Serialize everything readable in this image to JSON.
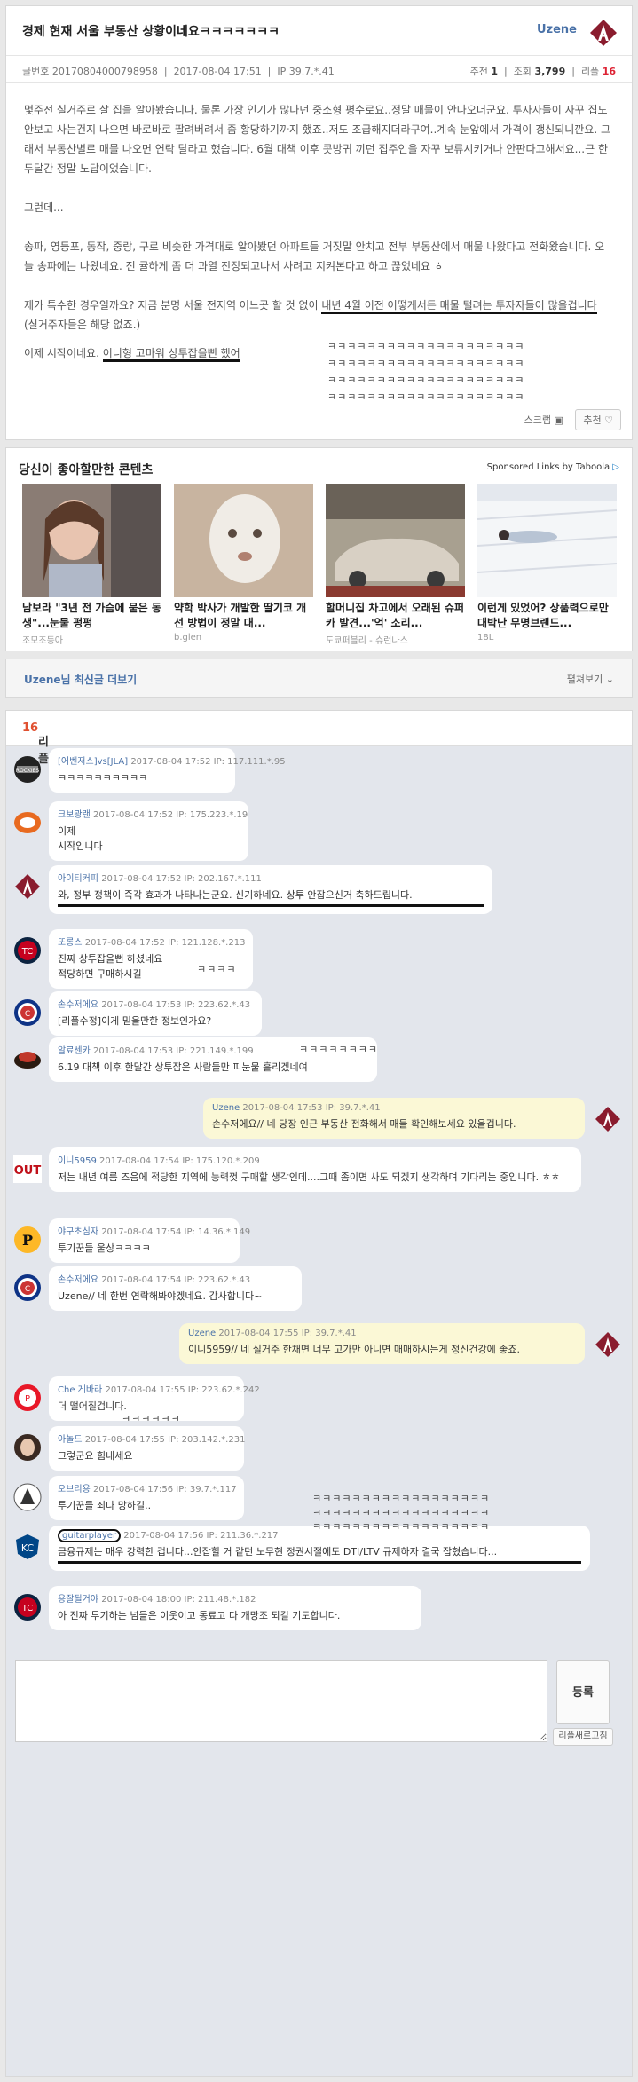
{
  "post": {
    "title": "경제 현재 서울 부동산 상황이네요ㅋㅋㅋㅋㅋㅋㅋ",
    "author": "Uzene",
    "number_label": "글번호",
    "number": "20170804000798958",
    "date": "2017-08-04 17:51",
    "ip_label": "IP",
    "ip": "39.7.*.41",
    "recommend_label": "추천",
    "recommend": "1",
    "views_label": "조회",
    "views": "3,799",
    "replies_label": "리플",
    "replies": "16",
    "paragraphs": [
      "몇주전 실거주로 살 집을 알아봤습니다. 물론 가장 인기가 많다던 중소형 평수로요..정말 매물이 안나오더군요. 투자자들이 자꾸 집도 안보고 사는건지 나오면 바로바로 팔려버려서 좀 황당하기까지 했죠..저도 조급해지더라구여..계속 눈앞에서 가격이 갱신되니깐요. 그래서 부동산별로 매물 나오면 연락 달라고 했습니다. 6월 대책 이후 콧방귀 끼던 집주인을 자꾸 보류시키거나 안판다고해서요...근 한두달간 정말 노답이었습니다.",
      "그런데...",
      "송파, 영등포, 동작, 중랑, 구로 비슷한 가격대로 알아봤던 아파트들 거짓말 안치고 전부 부동산에서 매물 나왔다고 전화왔습니다. 오늘 송파에는 나왔네요. 전 귤하게 좀 더 과열 진정되고나서 사려고 지켜본다고 하고 끊었네요 ㅎ",
      "제가 특수한 경우일까요? 지금 분명 서울 전지역 어느곳 할 것 없이 ",
      "내년 4월 이전 어떻게서든 매물 털려는 투자자들이 많을겁니다",
      " (실거주자들은 해당 없죠.)",
      "이제 시작이네요. ",
      "이니형 고마워 상투잡을뻔 했어"
    ],
    "laughs": [
      "ㅋㅋㅋㅋㅋㅋㅋㅋㅋㅋㅋㅋㅋㅋㅋㅋㅋㅋㅋㅋ",
      "ㅋㅋㅋㅋㅋㅋㅋㅋㅋㅋㅋㅋㅋㅋㅋㅋㅋㅋㅋㅋ",
      "ㅋㅋㅋㅋㅋㅋㅋㅋㅋㅋㅋㅋㅋㅋㅋㅋㅋㅋㅋㅋ",
      "ㅋㅋㅋㅋㅋㅋㅋㅋㅋㅋㅋㅋㅋㅋㅋㅋㅋㅋㅋㅋ"
    ],
    "scrap_label": "스크랩",
    "recommend_btn": "추천"
  },
  "taboola": {
    "title": "당신이 좋아할만한 콘텐츠",
    "sponsored": "Sponsored Links by Taboola",
    "items": [
      {
        "caption": "남보라 \"3년 전 가슴에 묻은 동생\"...눈물 펑펑",
        "source": "조모조등아"
      },
      {
        "caption": "약학 박사가 개발한 딸기코 개선 방법이 정말 대...",
        "source": "b.glen"
      },
      {
        "caption": "할머니집 차고에서 오래된 슈퍼카 발견...'억' 소리...",
        "source": "도쿄퍼블리 - 슈런나스"
      },
      {
        "caption": "이런게 있었어? 상품력으로만 대박난 무명브랜드...",
        "source": "18L"
      }
    ]
  },
  "more": {
    "title": "Uzene님 최신글 더보기",
    "toggle": "펼쳐보기"
  },
  "comments_header": {
    "label": "리플",
    "count": "16"
  },
  "comments": [
    {
      "name": "[어벤저스]vs[JLA]",
      "date": "2017-08-04 17:52",
      "ip": "117.111.*.95",
      "lines": [
        "ㅋㅋㅋㅋㅋㅋㅋㅋㅋㅋ"
      ]
    },
    {
      "name": "크보광랜",
      "date": "2017-08-04 17:52",
      "ip": "175.223.*.19",
      "lines": [
        "이제",
        "시작입니다"
      ]
    },
    {
      "name": "아이티커피",
      "date": "2017-08-04 17:52",
      "ip": "202.167.*.111",
      "lines": [
        "와, 정부 정책이 즉각 효과가 나타나는군요. 신기하네요. 상투 안잡으신거 축하드립니다."
      ]
    },
    {
      "name": "또롱스",
      "date": "2017-08-04 17:52",
      "ip": "121.128.*.213",
      "lines": [
        "진짜 상투잡을뻔 하셨네요",
        "적당하면 구매하시길"
      ],
      "laugh": "ㅋㅋㅋㅋ"
    },
    {
      "name": "손수저에요",
      "date": "2017-08-04 17:53",
      "ip": "223.62.*.43",
      "lines": [
        "[리플수정]이게 믿을만한 정보인가요?"
      ]
    },
    {
      "name": "알료센카",
      "date": "2017-08-04 17:53",
      "ip": "221.149.*.199",
      "lines": [
        "6.19 대책 이후 한달간 상투잡은 사람들만 피눈물 흘리겠네여"
      ],
      "laugh": "ㅋㅋㅋㅋㅋㅋㅋㅋ"
    },
    {
      "name": "Uzene",
      "date": "2017-08-04 17:53",
      "ip": "39.7.*.41",
      "lines": [
        "손수저에요// 네 당장 인근 부동산 전화해서 매물 확인해보세요 있을겁니다."
      ]
    },
    {
      "name": "이니5959",
      "date": "2017-08-04 17:54",
      "ip": "175.120.*.209",
      "lines": [
        "저는 내년 여름 즈음에 적당한 지역에 능력껏 구매할 생각인데....그때 좀이면 사도 되겠지 생각하며 기다리는 중입니다. ㅎㅎ"
      ]
    },
    {
      "name": "야구초심자",
      "date": "2017-08-04 17:54",
      "ip": "14.36.*.149",
      "lines": [
        "투기꾼들 울상ㅋㅋㅋㅋ"
      ]
    },
    {
      "name": "손수저에요",
      "date": "2017-08-04 17:54",
      "ip": "223.62.*.43",
      "lines": [
        "Uzene// 네 한번 연락해봐야겠네요. 감사합니다~"
      ]
    },
    {
      "name": "Uzene",
      "date": "2017-08-04 17:55",
      "ip": "39.7.*.41",
      "lines": [
        "이니5959// 네 실거주 한채면 너무 고가만 아니면 매매하시는게 정신건강에 좋죠."
      ]
    },
    {
      "name": "Che 게바라",
      "date": "2017-08-04 17:55",
      "ip": "223.62.*.242",
      "lines": [
        "더 떨어질겁니다."
      ],
      "laugh": "ㅋㅋㅋㅋㅋㅋ"
    },
    {
      "name": "아놀드",
      "date": "2017-08-04 17:55",
      "ip": "203.142.*.231",
      "lines": [
        "그렇군요 힘내세요"
      ]
    },
    {
      "name": "오브리용",
      "date": "2017-08-04 17:56",
      "ip": "39.7.*.117",
      "lines": [
        "투기꾼들 죄다 망하길.."
      ],
      "laugh": "ㅋㅋㅋㅋㅋㅋㅋㅋㅋㅋㅋㅋㅋㅋㅋㅋㅋㅋ"
    },
    {
      "name": "guitarplayer",
      "date": "2017-08-04 17:56",
      "ip": "211.36.*.217",
      "lines": [
        "금융규제는 매우 강력한 겁니다...안잡힐 거 같던 노무현 정권시절에도 DTI/LTV 규제하자 결국 잡혔습니다..."
      ],
      "laugh": "ㅋㅋㅋㅋㅋㅋㅋㅋㅋㅋㅋㅋㅋㅋㅋㅋㅋㅋ"
    },
    {
      "name": "용잘될거야",
      "date": "2017-08-04 18:00",
      "ip": "211.48.*.182",
      "lines": [
        "아 진짜 투기하는 넘들은 이웃이고 동료고 다 개망조 되길 기도합니다."
      ]
    }
  ],
  "form": {
    "submit": "등록",
    "refresh": "리플새로고침"
  }
}
